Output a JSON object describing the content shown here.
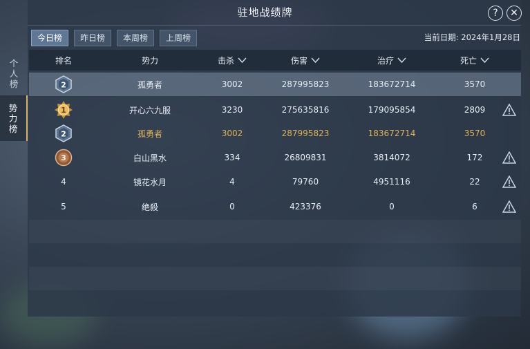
{
  "window": {
    "title": "驻地战绩牌"
  },
  "tabs": [
    {
      "label": "今日榜",
      "active": true
    },
    {
      "label": "昨日榜",
      "active": false
    },
    {
      "label": "本周榜",
      "active": false
    },
    {
      "label": "上周榜",
      "active": false
    }
  ],
  "date_label": "当前日期: 2024年1月28日",
  "side_tabs": [
    {
      "label": "个人榜",
      "chars": [
        "个",
        "人",
        "榜"
      ],
      "active": false
    },
    {
      "label": "势力榜",
      "chars": [
        "势",
        "力",
        "榜"
      ],
      "active": true
    }
  ],
  "columns": {
    "rank": "排名",
    "faction": "势力",
    "kills": "击杀",
    "damage": "伤害",
    "healing": "治疗",
    "deaths": "死亡"
  },
  "my_row": {
    "rank": "2",
    "faction": "孤勇者",
    "kills": "3002",
    "damage": "287995823",
    "healing": "183672714",
    "deaths": "3570"
  },
  "rows": [
    {
      "rank": "1",
      "badge": "gold",
      "faction": "开心六九服",
      "kills": "3230",
      "damage": "275635816",
      "healing": "179095854",
      "deaths": "2809",
      "warn": true
    },
    {
      "rank": "2",
      "badge": "silver",
      "faction": "孤勇者",
      "kills": "3002",
      "damage": "287995823",
      "healing": "183672714",
      "deaths": "3570",
      "warn": false,
      "me": true
    },
    {
      "rank": "3",
      "badge": "bronze",
      "faction": "白山黑水",
      "kills": "334",
      "damage": "26809831",
      "healing": "3814072",
      "deaths": "172",
      "warn": true
    },
    {
      "rank": "4",
      "badge": "none",
      "faction": "镜花水月",
      "kills": "4",
      "damage": "79760",
      "healing": "4951116",
      "deaths": "22",
      "warn": true
    },
    {
      "rank": "5",
      "badge": "none",
      "faction": "绝殺",
      "kills": "0",
      "damage": "423376",
      "healing": "0",
      "deaths": "6",
      "warn": true
    }
  ],
  "buttons": {
    "help": "?",
    "close": "✕"
  },
  "colors": {
    "gold": "#e0b35b",
    "highlight": "#78889c",
    "panel": "#2c3848"
  }
}
